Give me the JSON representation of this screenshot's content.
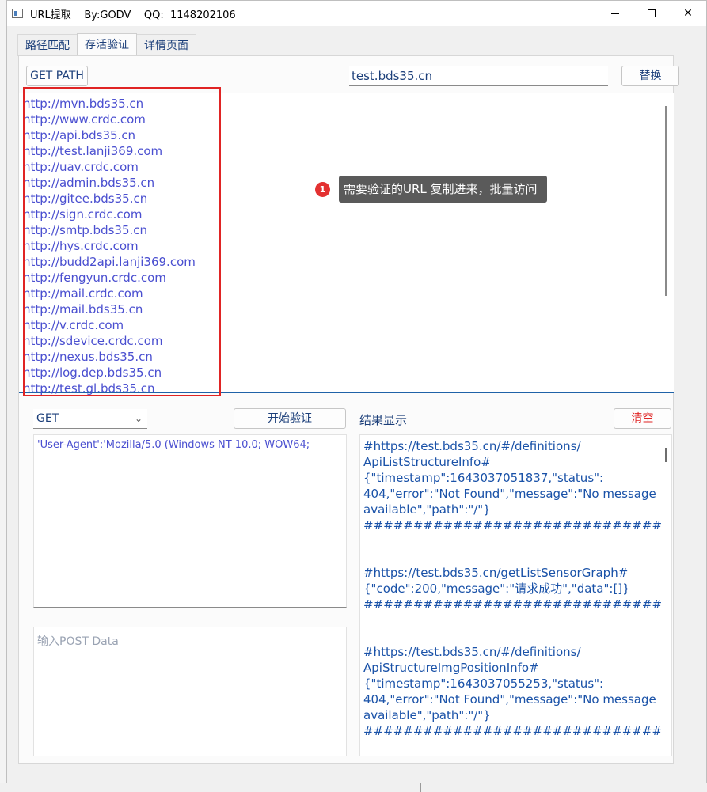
{
  "window": {
    "title": "URL提取    By:GODV    QQ:  1148202106",
    "min_label": "—",
    "max_label": "☐",
    "close_label": "✕"
  },
  "tabs": [
    {
      "label": "路径匹配",
      "active": false
    },
    {
      "label": "存活验证",
      "active": true
    },
    {
      "label": "详情页面",
      "active": false
    }
  ],
  "toolbar": {
    "get_path_label": "GET PATH",
    "path_value": "test.bds35.cn",
    "replace_label": "替换"
  },
  "urls": [
    "http://mvn.bds35.cn",
    "http://www.crdc.com",
    "http://api.bds35.cn",
    "http://test.lanji369.com",
    "http://uav.crdc.com",
    "http://admin.bds35.cn",
    "http://gitee.bds35.cn",
    "http://sign.crdc.com",
    "http://smtp.bds35.cn",
    "http://hys.crdc.com",
    "http://budd2api.lanji369.com",
    "http://fengyun.crdc.com",
    "http://mail.crdc.com",
    "http://mail.bds35.cn",
    "http://v.crdc.com",
    "http://sdevice.crdc.com",
    "http://nexus.bds35.cn",
    "http://log.dep.bds35.cn",
    "http://test.gl.bds35.cn"
  ],
  "annotation": {
    "number": "1",
    "text": "需要验证的URL 复制进来，批量访问",
    "highlight_color": "#e02424"
  },
  "controls": {
    "method_value": "GET",
    "start_label": "开始验证",
    "result_label": "结果显示",
    "clear_label": "清空",
    "clear_color": "#e02424",
    "headers_value": "'User-Agent':'Mozilla/5.0 (Windows NT 10.0; WOW64;",
    "post_placeholder": "输入POST Data"
  },
  "results": [
    "#https://test.bds35.cn/#/definitions/",
    "ApiListStructureInfo#",
    "{\"timestamp\":1643037051837,\"status\":",
    "404,\"error\":\"Not Found\",\"message\":\"No message",
    "available\",\"path\":\"/\"}",
    "##############################",
    "",
    "",
    "#https://test.bds35.cn/getListSensorGraph#",
    "{\"code\":200,\"message\":\"请求成功\",\"data\":[]}",
    "##############################",
    "",
    "",
    "#https://test.bds35.cn/#/definitions/",
    "ApiStructureImgPositionInfo#",
    "{\"timestamp\":1643037055253,\"status\":",
    "404,\"error\":\"Not Found\",\"message\":\"No message",
    "available\",\"path\":\"/\"}",
    "##############################"
  ]
}
